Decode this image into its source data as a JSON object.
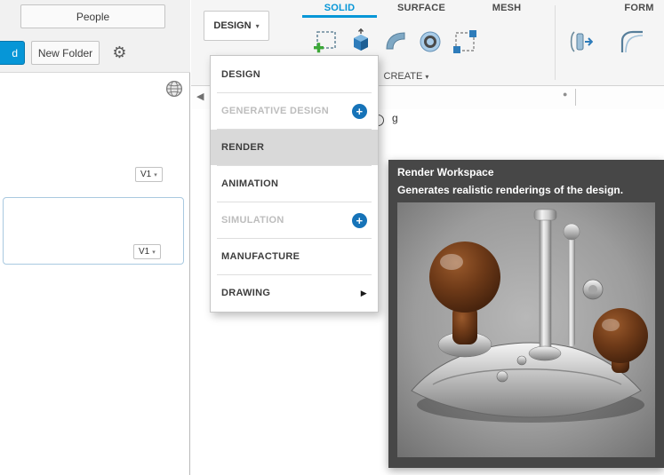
{
  "icons": {
    "caret_down": "▾",
    "gear": "⚙",
    "nav_back": "◀",
    "unsaved_dot": "●",
    "submenu_arrow": "▶",
    "premium_plus": "+"
  },
  "left_panel": {
    "people_button": "People",
    "upload_button_fragment": "d",
    "new_folder_button": "New Folder",
    "items": [
      {
        "version": "V1",
        "selected": false
      },
      {
        "version": "V1",
        "selected": true
      }
    ]
  },
  "toolbar": {
    "workspace_button": "DESIGN",
    "tabs": [
      {
        "label": "SOLID",
        "active": true
      },
      {
        "label": "SURFACE",
        "active": false
      },
      {
        "label": "MESH",
        "active": false
      },
      {
        "label": "FORM",
        "active": false
      }
    ],
    "create_group_label": "CREATE",
    "icon_names": [
      "create-sketch",
      "extrude",
      "revolve",
      "hole",
      "pattern",
      "press-pull",
      "fillet"
    ]
  },
  "canvas": {
    "fragment_text": "g"
  },
  "workspace_menu": {
    "items": [
      {
        "label": "DESIGN",
        "state": "normal"
      },
      {
        "label": "GENERATIVE DESIGN",
        "state": "locked",
        "badge": true
      },
      {
        "label": "RENDER",
        "state": "highlighted"
      },
      {
        "label": "ANIMATION",
        "state": "normal"
      },
      {
        "label": "SIMULATION",
        "state": "locked",
        "badge": true
      },
      {
        "label": "MANUFACTURE",
        "state": "normal"
      },
      {
        "label": "DRAWING",
        "state": "normal",
        "has_submenu": true
      }
    ]
  },
  "tooltip": {
    "title": "Render Workspace",
    "description": "Generates realistic renderings of the design."
  },
  "colors": {
    "accent_blue": "#0696d7",
    "premium_badge_blue": "#1673b8",
    "tooltip_bg": "#474747",
    "menu_highlight": "#d9d9d9"
  }
}
